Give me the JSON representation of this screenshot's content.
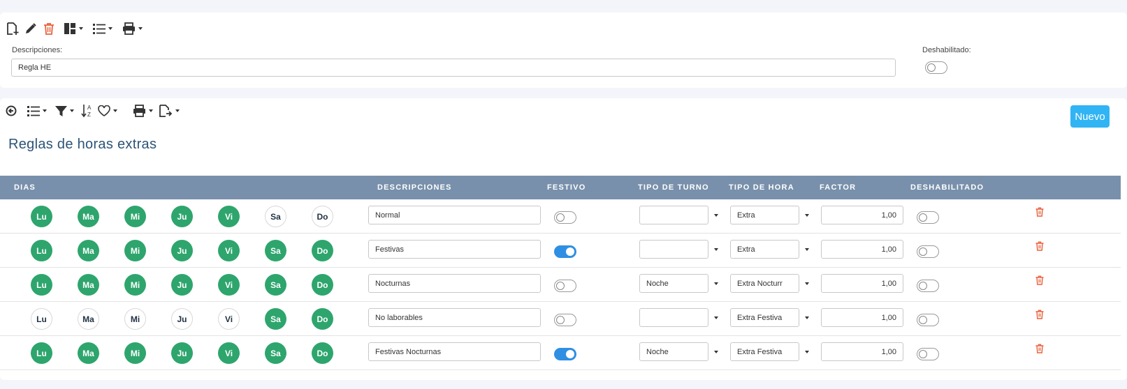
{
  "top_form": {
    "descripciones_label": "Descripciones:",
    "descripciones_value": "Regla HE",
    "deshabilitado_label": "Deshabilitado:",
    "deshabilitado_on": false
  },
  "main": {
    "title": "Reglas de horas extras",
    "new_button": "Nuevo",
    "columns": {
      "dias": "DIAS",
      "descripciones": "DESCRIPCIONES",
      "festivo": "FESTIVO",
      "tipo_turno": "TIPO DE TURNO",
      "tipo_hora": "TIPO DE HORA",
      "factor": "FACTOR",
      "deshabilitado": "DESHABILITADO"
    },
    "day_labels": [
      "Lu",
      "Ma",
      "Mi",
      "Ju",
      "Vi",
      "Sa",
      "Do"
    ],
    "rows": [
      {
        "days": [
          true,
          true,
          true,
          true,
          true,
          false,
          false
        ],
        "descripcion": "Normal",
        "festivo": false,
        "tipo_turno": "",
        "tipo_hora": "Extra",
        "factor": "1,00",
        "deshabilitado": false
      },
      {
        "days": [
          true,
          true,
          true,
          true,
          true,
          true,
          true
        ],
        "descripcion": "Festivas",
        "festivo": true,
        "tipo_turno": "",
        "tipo_hora": "Extra",
        "factor": "1,00",
        "deshabilitado": false
      },
      {
        "days": [
          true,
          true,
          true,
          true,
          true,
          true,
          true
        ],
        "descripcion": "Nocturnas",
        "festivo": false,
        "tipo_turno": "Noche",
        "tipo_hora": "Extra Nocturr",
        "factor": "1,00",
        "deshabilitado": false
      },
      {
        "days": [
          false,
          false,
          false,
          false,
          false,
          true,
          true
        ],
        "descripcion": "No laborables",
        "festivo": false,
        "tipo_turno": "",
        "tipo_hora": "Extra Festiva",
        "factor": "1,00",
        "deshabilitado": false
      },
      {
        "days": [
          true,
          true,
          true,
          true,
          true,
          true,
          true
        ],
        "descripcion": "Festivas Nocturnas",
        "festivo": true,
        "tipo_turno": "Noche",
        "tipo_hora": "Extra Festiva",
        "factor": "1,00",
        "deshabilitado": false
      }
    ]
  },
  "colors": {
    "day_active": "#2ea56d",
    "header_bg": "#7890ab",
    "accent": "#31b4f3",
    "toggle_on": "#2f8fe3",
    "danger": "#e8613c"
  }
}
